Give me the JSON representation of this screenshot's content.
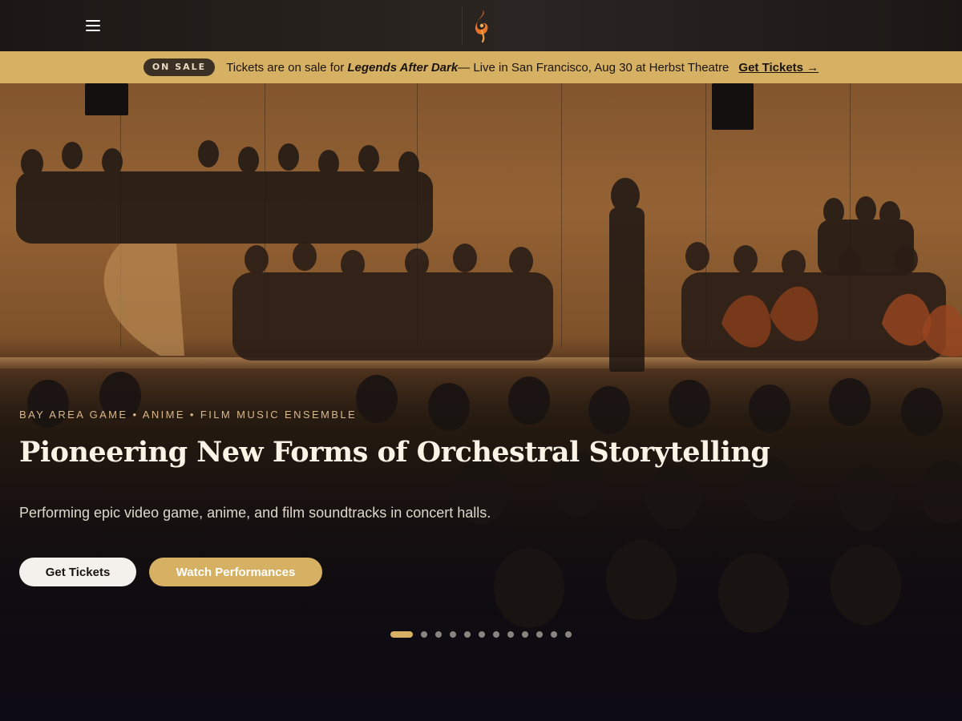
{
  "header": {
    "menu_icon": "hamburger-menu-icon",
    "logo_icon": "flame-note-logo-icon"
  },
  "banner": {
    "badge": "ON SALE",
    "message_prefix": "Tickets are on sale for ",
    "event_name": "Legends After Dark",
    "message_suffix": "— Live in San Francisco, Aug 30 at Herbst Theatre",
    "link_label": "Get Tickets →"
  },
  "hero": {
    "eyebrow": "BAY AREA GAME • ANIME • FILM MUSIC ENSEMBLE",
    "headline": "Pioneering New Forms of Orchestral Storytelling",
    "subheadline": "Performing epic video game, anime, and film soundtracks in concert halls.",
    "primary_button": "Get Tickets",
    "secondary_button": "Watch Performances",
    "background_image": "orchestra-concert-photo"
  },
  "carousel": {
    "total_slides": 12,
    "active_slide": 1
  },
  "colors": {
    "accent_gold": "#d7b163",
    "topbar": "#211c19",
    "background": "#0d0b14"
  }
}
